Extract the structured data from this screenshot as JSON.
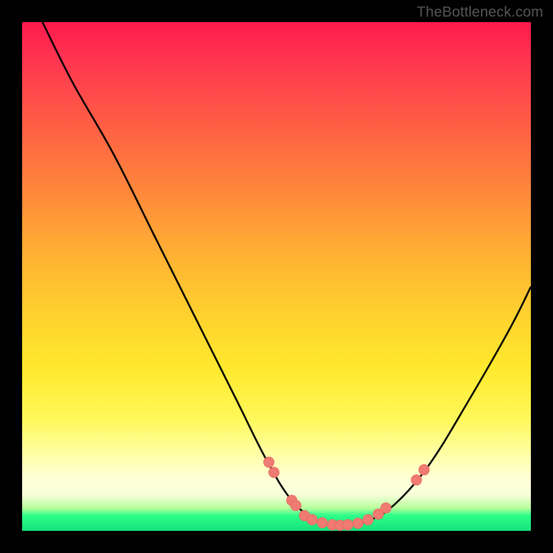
{
  "watermark": "TheBottleneck.com",
  "chart_data": {
    "type": "line",
    "title": "",
    "xlabel": "",
    "ylabel": "",
    "xlim": [
      0,
      100
    ],
    "ylim": [
      0,
      100
    ],
    "curve": {
      "name": "bottleneck-curve",
      "points": [
        {
          "x": 4,
          "y": 100
        },
        {
          "x": 10,
          "y": 88
        },
        {
          "x": 18,
          "y": 74
        },
        {
          "x": 26,
          "y": 58
        },
        {
          "x": 34,
          "y": 42
        },
        {
          "x": 42,
          "y": 26
        },
        {
          "x": 48,
          "y": 14
        },
        {
          "x": 53,
          "y": 6
        },
        {
          "x": 58,
          "y": 2
        },
        {
          "x": 63,
          "y": 1
        },
        {
          "x": 68,
          "y": 2
        },
        {
          "x": 73,
          "y": 5
        },
        {
          "x": 80,
          "y": 13
        },
        {
          "x": 88,
          "y": 26
        },
        {
          "x": 96,
          "y": 40
        },
        {
          "x": 100,
          "y": 48
        }
      ]
    },
    "markers": {
      "name": "measured-points",
      "points": [
        {
          "x": 48.5,
          "y": 13.5
        },
        {
          "x": 49.5,
          "y": 11.5
        },
        {
          "x": 53.0,
          "y": 6.0
        },
        {
          "x": 53.8,
          "y": 5.0
        },
        {
          "x": 55.5,
          "y": 3.0
        },
        {
          "x": 57.0,
          "y": 2.2
        },
        {
          "x": 59.0,
          "y": 1.6
        },
        {
          "x": 61.0,
          "y": 1.2
        },
        {
          "x": 62.5,
          "y": 1.1
        },
        {
          "x": 64.0,
          "y": 1.2
        },
        {
          "x": 66.0,
          "y": 1.5
        },
        {
          "x": 68.0,
          "y": 2.2
        },
        {
          "x": 70.0,
          "y": 3.3
        },
        {
          "x": 71.5,
          "y": 4.5
        },
        {
          "x": 77.5,
          "y": 10.0
        },
        {
          "x": 79.0,
          "y": 12.0
        }
      ]
    },
    "colors": {
      "curve": "#000000",
      "marker_fill": "#ef7b73",
      "marker_stroke": "#e76a62",
      "gradient_top": "#ff1a4d",
      "gradient_bottom": "#17e07a"
    }
  }
}
